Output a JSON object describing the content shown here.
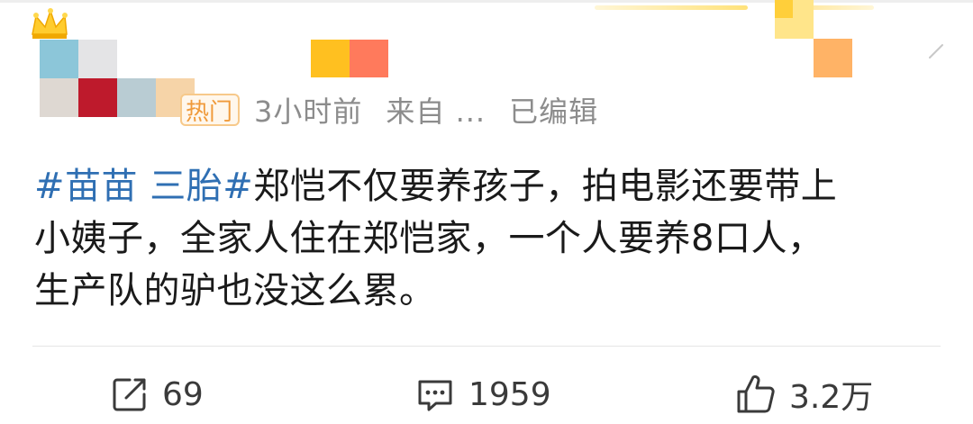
{
  "post": {
    "badge": "热门",
    "time": "3小时前",
    "source": "来自 ...",
    "edited": "已编辑",
    "hashtag1": "#苗苗 三胎#",
    "text_line1": "郑恺不仅要养孩子，拍电影还要带上",
    "text_line2": "小姨子，全家人住在郑恺家，一个人要养8口人，",
    "text_line3": "生产队的驴也没这么累。"
  },
  "actions": {
    "repost_count": "69",
    "comment_count": "1959",
    "like_count": "3.2万"
  },
  "icons": {
    "crown": "crown-icon",
    "repost": "share-icon",
    "comment": "comment-icon",
    "like": "thumbs-up-icon",
    "more": "chevron-down-icon"
  },
  "colors": {
    "hashtag": "#2f6fb3",
    "badge": "#f09a3a",
    "meta": "#8c8c8c",
    "text": "#1a1a1a"
  }
}
